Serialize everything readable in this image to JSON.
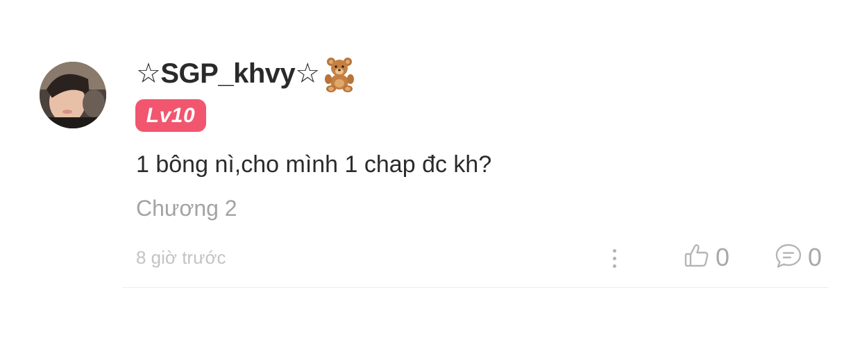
{
  "comment": {
    "username": "☆SGP_khvy☆",
    "username_emoji": "teddy-bear-icon",
    "level_badge": "Lv10",
    "text": "1 bông nì,cho mình 1 chap đc kh?",
    "chapter": "Chương 2",
    "timestamp": "8 giờ trước",
    "like_count": "0",
    "reply_count": "0"
  },
  "colors": {
    "badge": "#f2566f",
    "text": "#2b2b2b",
    "muted": "#a3a3a3",
    "timestamp": "#c3c3c3",
    "divider": "#ececec"
  },
  "icons": {
    "more": "more-vertical-icon",
    "like": "thumbs-up-icon",
    "reply": "speech-bubble-icon"
  }
}
